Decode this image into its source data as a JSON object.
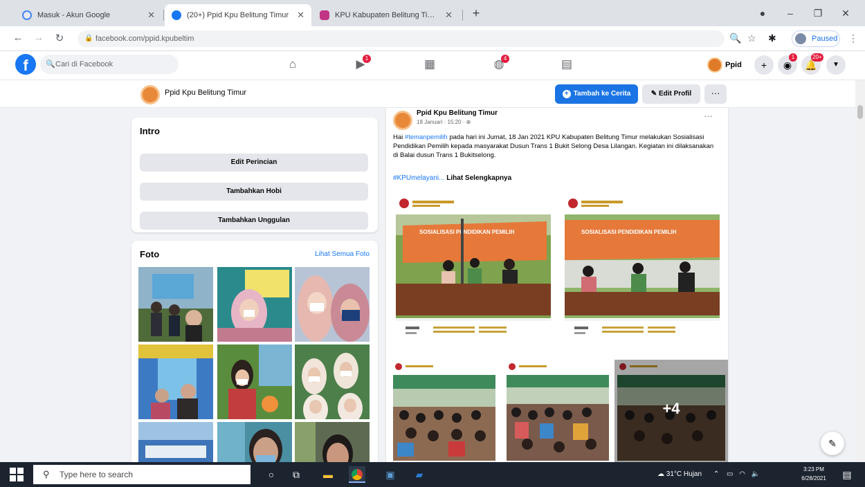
{
  "browser": {
    "tabs": [
      {
        "title": "Masuk - Akun Google",
        "favicon_color": "#4285f4"
      },
      {
        "title": "(20+) Ppid Kpu Belitung Timur",
        "favicon_color": "#1877f2"
      },
      {
        "title": "KPU Kabupaten Belitung Timur",
        "favicon_color": "#c13584"
      }
    ],
    "new_tab": "+",
    "url": "facebook.com/ppid.kpubeltim",
    "profile_status": "Paused"
  },
  "facebook": {
    "search_placeholder": "Cari di Facebook",
    "profile_short": "Ppid",
    "badges": {
      "watch": "1",
      "gaming": "4",
      "messenger": "1",
      "notifications": "20+"
    }
  },
  "pagebar": {
    "name": "Ppid Kpu Belitung Timur",
    "story_button": "Tambah ke Cerita",
    "edit_button": "Edit Profil",
    "more_button": "···"
  },
  "intro": {
    "title": "Intro",
    "buttons": [
      "Edit Perincian",
      "Tambahkan Hobi",
      "Tambahkan Unggulan"
    ]
  },
  "photos": {
    "title": "Foto",
    "see_all": "Lihat Semua Foto"
  },
  "post": {
    "author": "Ppid Kpu Belitung Timur",
    "time": "18 Januari · 15:20 · ⊕",
    "body_prefix": "Hai ",
    "body_tag": "#temanpemilih",
    "body_text": " pada hari ini Jumat, 18 Jan 2021 KPU Kabupaten Belitung Timur melakukan Sosialisasi Pendidikan Pemilih kepada masyarakat Dusun Trans 1 Bukit Selong Desa Lilangan. Kegiatan ini dilaksanakan di Balai dusun Trans 1 Bukitselong.",
    "hashtag_more": "#KPUmelayani...",
    "see_more": "Lihat Selengkapnya",
    "banner_text": "SOSIALISASI PENDIDIKAN PEMILIH",
    "plus_count": "+4"
  },
  "taskbar": {
    "search_placeholder": "Type here to search",
    "weather": "31°C  Hujan",
    "time": "3:23 PM",
    "date": "6/28/2021"
  }
}
